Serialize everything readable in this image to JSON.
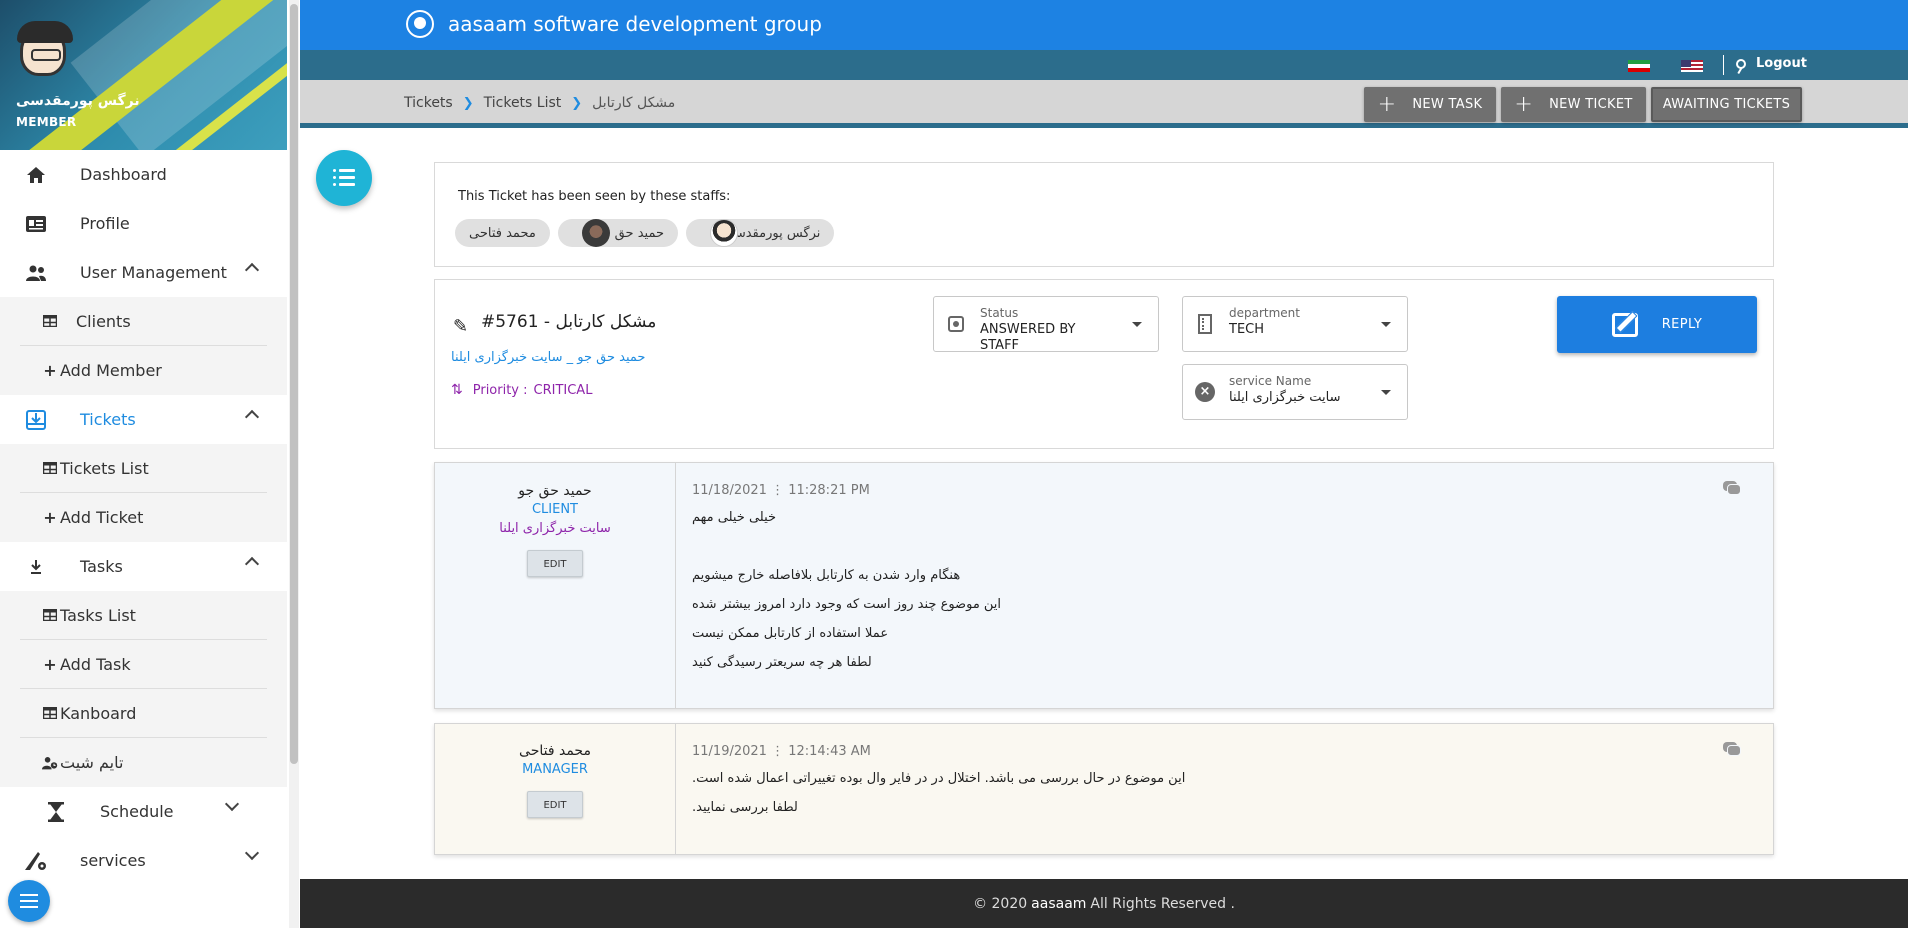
{
  "sidebar": {
    "user_name": "نرگس پورمقدسی",
    "user_role": "MEMBER",
    "items": [
      {
        "label": "Dashboard"
      },
      {
        "label": "Profile"
      },
      {
        "label": "User Management"
      },
      {
        "label": "Tickets"
      },
      {
        "label": "Tasks"
      },
      {
        "label": "Schedule"
      },
      {
        "label": "services"
      }
    ],
    "user_mgmt_sub": [
      {
        "label": "Clients"
      },
      {
        "label": "Add Member"
      }
    ],
    "tickets_sub": [
      {
        "label": "Tickets List"
      },
      {
        "label": "Add Ticket"
      }
    ],
    "tasks_sub": [
      {
        "label": "Tasks List"
      },
      {
        "label": "Add Task"
      },
      {
        "label": "Kanboard"
      },
      {
        "label": "تایم شیت"
      }
    ]
  },
  "header": {
    "brand": "aasaam software development group",
    "logout": "Logout"
  },
  "breadcrumb": {
    "items": [
      "Tickets",
      "Tickets List",
      "مشکل کارتابل"
    ]
  },
  "toolbar": {
    "new_task": "NEW TASK",
    "new_ticket": "NEW TICKET",
    "awaiting": "AWAITING TICKETS"
  },
  "seen": {
    "title": "This Ticket has been seen by these staffs:",
    "staff": [
      "نرگس پورمقدسی",
      "حمید حق جو",
      "محمد فتاحی"
    ]
  },
  "ticket": {
    "number": "#5761",
    "subject": "مشکل کارتابل",
    "meta": "حمید حق جو _ سایت خبرگزاری ایلنا",
    "priority_label": "Priority :",
    "priority": "CRITICAL",
    "status_label": "Status",
    "status": "ANSWERED BY STAFF",
    "department_label": "department",
    "department": "TECH",
    "service_label": "service Name",
    "service": "سایت خبرگزاری ایلنا",
    "reply": "REPLY"
  },
  "messages": [
    {
      "author": "حمید حق جو",
      "role": "CLIENT",
      "service": "سایت خبرگزاری ایلنا",
      "edit": "EDIT",
      "date": "11/18/2021",
      "time": "11:28:21 PM",
      "lines": [
        "خیلی خیلی مهم",
        "",
        "هنگام وارد شدن به کارتابل بلافاصله خارج میشویم",
        "این موضوع چند روز است که وجود دارد امروز بیشتر شده",
        "عملا استفاده از کارتابل ممکن نیست",
        "لطفا هر چه سریعتر رسیدگی کنید"
      ]
    },
    {
      "author": "محمد فتاحی",
      "role": "MANAGER",
      "edit": "EDIT",
      "date": "11/19/2021",
      "time": "12:14:43 AM",
      "lines": [
        "این موضوع در حال بررسی می باشد. اختلال در در فایر وال بوده تغییراتی اعمال شده است.",
        "لطفا بررسی نمایید."
      ]
    }
  ],
  "footer": {
    "prefix": "© 2020",
    "brand": "aasaam",
    "suffix": "All Rights Reserved ."
  },
  "icons": {
    "menu": [
      "home-icon",
      "id-card-icon",
      "users-icon",
      "ticket-icon",
      "download-icon",
      "hourglass-icon",
      "services-icon"
    ],
    "accent": "#1d82e3",
    "subbar": "#2c6d8c",
    "fab": "#1fb4d6",
    "priority_color": "#8e24aa"
  }
}
